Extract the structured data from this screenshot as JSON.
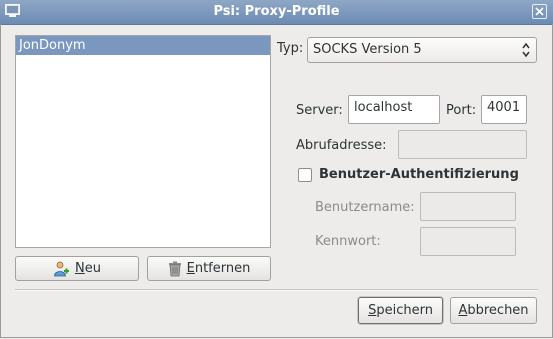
{
  "window": {
    "title": "Psi: Proxy-Profile",
    "icon": "window-menu-icon",
    "close_icon": "close-icon"
  },
  "profiles": {
    "items": [
      {
        "label": "JonDonym",
        "selected": true
      }
    ],
    "new_button": "Neu",
    "remove_button": "Entfernen"
  },
  "form": {
    "type_label": "Typ:",
    "type_value": "SOCKS Version 5",
    "server_label": "Server:",
    "server_value": "localhost",
    "port_label": "Port:",
    "port_value": "4001",
    "fetch_url_label": "Abrufadresse:",
    "fetch_url_value": "",
    "auth_checkbox_label": "Benutzer-Authentifizierung",
    "auth_checked": false,
    "username_label": "Benutzername:",
    "username_value": "",
    "password_label": "Kennwort:",
    "password_value": ""
  },
  "footer": {
    "save_button": "Speichern",
    "cancel_button": "Abbrechen"
  }
}
